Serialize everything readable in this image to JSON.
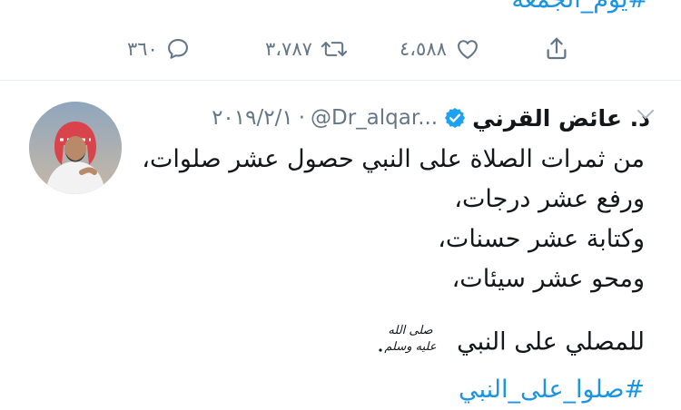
{
  "previous_tweet": {
    "hashtag": "#يوم_الجمعة",
    "actions": {
      "replies": "٣٦٠",
      "retweets": "٣،٧٨٧",
      "likes": "٤،٥٨٨"
    }
  },
  "tweet": {
    "author_name": "د. عائض القرني",
    "handle": "@Dr_alqar...",
    "separator": "·",
    "date": "٢٠١٩/٢/١",
    "lines": [
      "من ثمرات الصلاة على النبي حصول عشر صلوات،",
      "ورفع عشر درجات،",
      "وكتابة عشر حسنات،",
      "ومحو عشر سيئات،"
    ],
    "closing_line": "للمصلي على النبي",
    "salawat_text": "صلى الله عليه وسلم",
    "hashtag": "#صلوا_على_النبي"
  },
  "colors": {
    "link": "#1b95e0",
    "secondary": "#657786",
    "verified": "#1da1f2",
    "divider": "#e6ecf0"
  },
  "icons": {
    "reply": "reply-icon",
    "retweet": "retweet-icon",
    "like": "heart-icon",
    "share": "share-icon",
    "verified": "verified-badge-icon",
    "caret": "chevron-down-icon"
  }
}
